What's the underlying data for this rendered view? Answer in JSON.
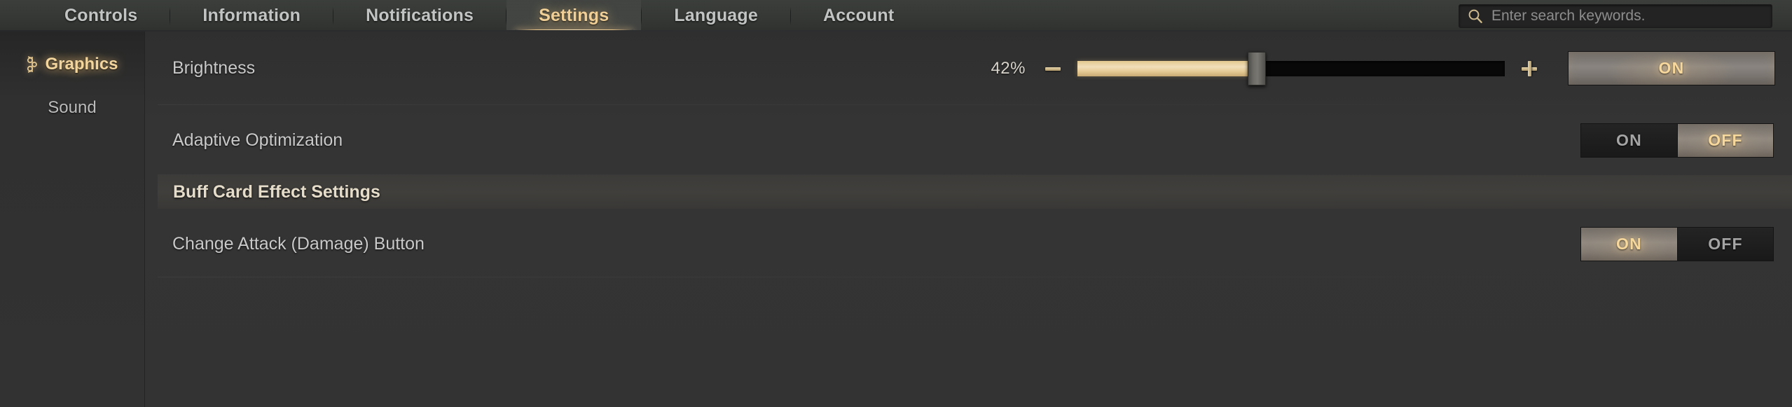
{
  "nav": {
    "tabs": [
      {
        "label": "Controls",
        "active": false
      },
      {
        "label": "Information",
        "active": false
      },
      {
        "label": "Notifications",
        "active": false
      },
      {
        "label": "Settings",
        "active": true
      },
      {
        "label": "Language",
        "active": false
      },
      {
        "label": "Account",
        "active": false
      }
    ]
  },
  "search": {
    "placeholder": "Enter search keywords.",
    "value": "",
    "icon": "search-icon"
  },
  "sidebar": {
    "items": [
      {
        "label": "Graphics",
        "active": true,
        "icon": "ornament-icon"
      },
      {
        "label": "Sound",
        "active": false
      }
    ]
  },
  "settings": {
    "brightness": {
      "label": "Brightness",
      "percent": "42%",
      "value": 42,
      "decrease_label": "−",
      "increase_label": "+",
      "toggle_label": "ON",
      "toggle_state": "on"
    },
    "adaptive_optimization": {
      "label": "Adaptive Optimization",
      "on_label": "ON",
      "off_label": "OFF",
      "selected": "OFF"
    },
    "section_buff": {
      "title": "Buff Card Effect Settings"
    },
    "change_attack": {
      "label": "Change Attack (Damage) Button",
      "on_label": "ON",
      "off_label": "OFF",
      "selected": "ON"
    }
  },
  "colors": {
    "accent_gold": "#f0cf96",
    "slider_fill": "#e6cb95",
    "text_primary": "#c9c9c9",
    "panel_bg": "#333333"
  }
}
